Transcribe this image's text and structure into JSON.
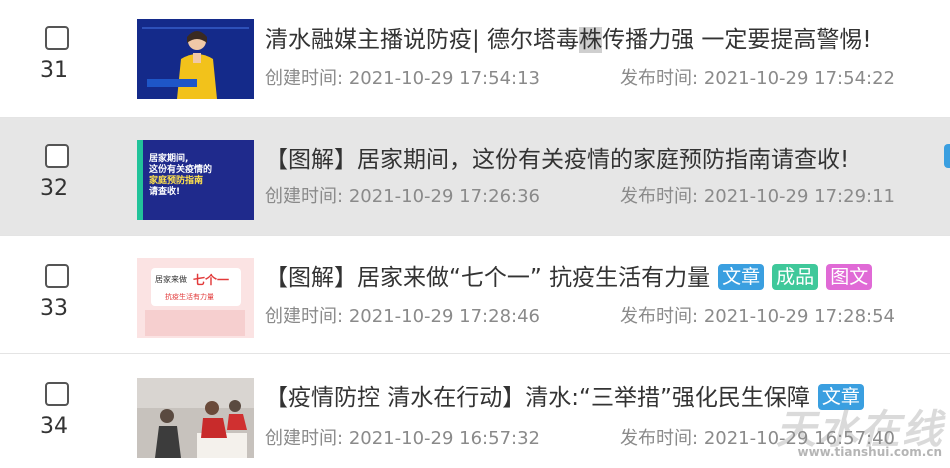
{
  "rows": [
    {
      "index": "31",
      "title_pre": "清水融媒主播说防疫| 德尔塔毒",
      "title_hl": "株",
      "title_post": "传播力强 一定要提高警惕!",
      "created_label": "创建时间:",
      "created": "2021-10-29 17:54:13",
      "published_label": "发布时间:",
      "published": "2021-10-29 17:54:22"
    },
    {
      "index": "32",
      "title": "【图解】居家期间，这份有关疫情的家庭预防指南请查收!",
      "created_label": "创建时间:",
      "created": "2021-10-29 17:26:36",
      "published_label": "发布时间:",
      "published": "2021-10-29 17:29:11",
      "thumb_text": [
        "居家期间,",
        "这份有关疫情的",
        "家庭预防指南",
        "请查收!"
      ]
    },
    {
      "index": "33",
      "title": "【图解】居家来做“七个一” 抗疫生活有力量",
      "tags": [
        "文章",
        "成品",
        "图文"
      ],
      "created_label": "创建时间:",
      "created": "2021-10-29 17:28:46",
      "published_label": "发布时间:",
      "published": "2021-10-29 17:28:54",
      "thumb_text": [
        "居家来做",
        "七个一",
        "抗疫生活有力量"
      ]
    },
    {
      "index": "34",
      "title": "【疫情防控 清水在行动】清水:“三举措”强化民生保障",
      "tags": [
        "文章"
      ],
      "created_label": "创建时间:",
      "created": "2021-10-29 16:57:32",
      "published_label": "发布时间:",
      "published": "2021-10-29 16:57:40"
    }
  ],
  "watermark": {
    "name": "天水在线",
    "url": "www.tianshui.com.cn"
  },
  "colors": {
    "tag_blue": "#3a9fe0",
    "tag_green": "#3fc89a",
    "tag_pink": "#e06ad6",
    "selected_row": "#e6e6e6"
  }
}
